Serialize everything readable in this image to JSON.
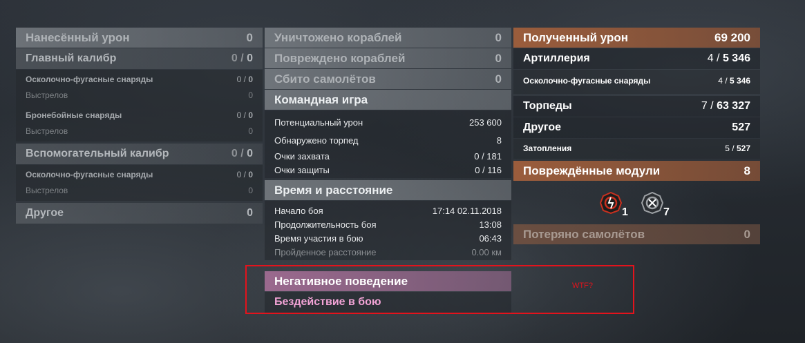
{
  "col1": {
    "damage_dealt": {
      "label": "Нанесённый урон",
      "value": "0"
    },
    "main_battery": {
      "label": "Главный калибр",
      "value_left": "0 /",
      "value_right": "0"
    },
    "main_items": [
      {
        "label": "Осколочно-фугасные снаряды",
        "value_left": "0 /",
        "value_right": "0"
      },
      {
        "label": "Выстрелов",
        "value": "0"
      },
      {
        "label": "Бронебойные снаряды",
        "value_left": "0 /",
        "value_right": "0"
      },
      {
        "label": "Выстрелов",
        "value": "0"
      }
    ],
    "secondary": {
      "label": "Вспомогательный калибр",
      "value_left": "0 /",
      "value_right": "0"
    },
    "secondary_items": [
      {
        "label": "Осколочно-фугасные снаряды",
        "value_left": "0 /",
        "value_right": "0"
      },
      {
        "label": "Выстрелов",
        "value": "0"
      }
    ],
    "other": {
      "label": "Другое",
      "value": "0"
    }
  },
  "col2": {
    "ships_destroyed": {
      "label": "Уничтожено кораблей",
      "value": "0"
    },
    "ships_damaged": {
      "label": "Повреждено кораблей",
      "value": "0"
    },
    "planes_shot": {
      "label": "Сбито самолётов",
      "value": "0"
    },
    "team_play": {
      "label": "Командная игра",
      "items": [
        {
          "label": "Потенциальный урон",
          "value": "253 600"
        },
        {
          "label": "Обнаружено торпед",
          "value": "8"
        },
        {
          "label": "Очки захвата",
          "value": "0 / 181"
        },
        {
          "label": "Очки защиты",
          "value": "0 / 116"
        }
      ]
    },
    "time_distance": {
      "label": "Время и расстояние",
      "items": [
        {
          "label": "Начало боя",
          "value": "17:14  02.11.2018"
        },
        {
          "label": "Продолжительность боя",
          "value": "13:08"
        },
        {
          "label": "Время участия в бою",
          "value": "06:43"
        },
        {
          "label": "Пройденное расстояние",
          "value": "0.00 км"
        }
      ]
    },
    "negative": {
      "label": "Негативное поведение",
      "value": "Бездействие в бою"
    }
  },
  "col3": {
    "damage_received": {
      "label": "Полученный урон",
      "value": "69 200"
    },
    "artillery": {
      "label": "Артиллерия",
      "value_left": "4 /",
      "value_right": "5 346"
    },
    "art_items": [
      {
        "label": "Осколочно-фугасные снаряды",
        "value_left": "4 /",
        "value_right": "5 346"
      }
    ],
    "torpedoes": {
      "label": "Торпеды",
      "value_left": "7 /",
      "value_right": "63 327"
    },
    "other": {
      "label": "Другое",
      "value": "527"
    },
    "other_items": [
      {
        "label": "Затопления",
        "value_left": "5 /",
        "value_right": "527"
      }
    ],
    "damaged_modules": {
      "label": "Повреждённые модули",
      "value": "8"
    },
    "module_icons": [
      {
        "icon": "damaged-module-icon",
        "count": "1"
      },
      {
        "icon": "destroyed-module-icon",
        "count": "7"
      }
    ],
    "planes_lost": {
      "label": "Потеряно самолётов",
      "value": "0"
    }
  },
  "annotation": {
    "text": "WTF?",
    "color": "#e3131c"
  },
  "colors": {
    "accent_brown": "#a05f3c",
    "negative_pink": "#f2a3d6",
    "negative_header": "#a56e96"
  }
}
